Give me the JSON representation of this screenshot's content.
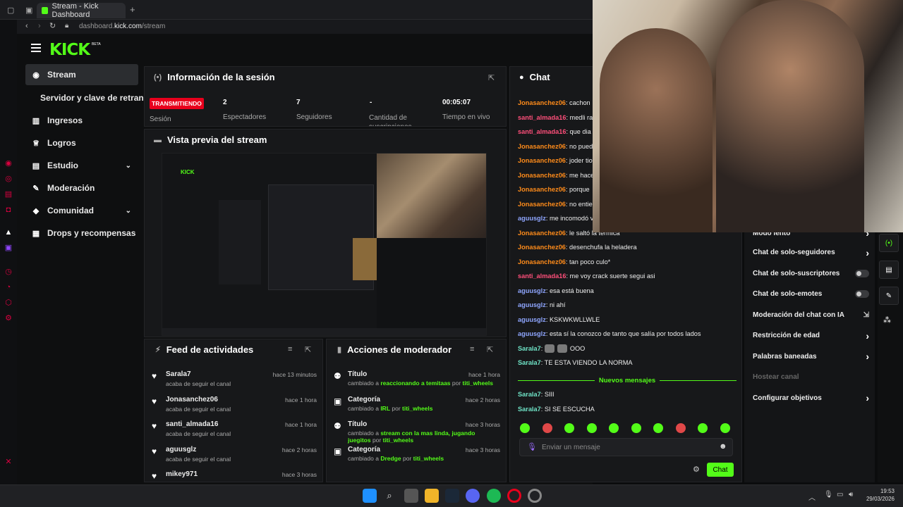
{
  "browser": {
    "tab_title": "Stream - Kick Dashboard",
    "url_domain": "dashboard.",
    "url_host": "kick.com",
    "url_path": "/stream"
  },
  "brand": {
    "logo": "KICK",
    "beta": "BETA",
    "accent": "#53fc18",
    "live_red": "#e8001c"
  },
  "sidebar": {
    "items": [
      {
        "label": "Stream",
        "icon": "broadcast-icon"
      },
      {
        "label": "Servidor y clave de retransmisión",
        "icon": ""
      },
      {
        "label": "Ingresos",
        "icon": "chart-icon"
      },
      {
        "label": "Logros",
        "icon": "trophy-icon"
      },
      {
        "label": "Estudio",
        "icon": "studio-icon"
      },
      {
        "label": "Moderación",
        "icon": "wrench-icon"
      },
      {
        "label": "Comunidad",
        "icon": "community-icon"
      },
      {
        "label": "Drops y recompensas",
        "icon": "gift-icon"
      }
    ]
  },
  "session": {
    "title": "Información de la sesión",
    "live_badge": "TRANSMITIENDO",
    "live_label": "Sesión",
    "stats": [
      {
        "value": "2",
        "label": "Espectadores"
      },
      {
        "value": "7",
        "label": "Seguidores"
      },
      {
        "value": "-",
        "label": "Cantidad de suscripciones"
      },
      {
        "value": "00:05:07",
        "label": "Tiempo en vivo"
      }
    ]
  },
  "preview": {
    "title": "Vista previa del stream"
  },
  "feed": {
    "title": "Feed de actividades",
    "items": [
      {
        "name": "Sarala7",
        "action": "acaba de seguir el canal",
        "time": "hace 13 minutos"
      },
      {
        "name": "Jonasanchez06",
        "action": "acaba de seguir el canal",
        "time": "hace 1 hora"
      },
      {
        "name": "santi_almada16",
        "action": "acaba de seguir el canal",
        "time": "hace 1 hora"
      },
      {
        "name": "aguusglz",
        "action": "acaba de seguir el canal",
        "time": "hace 2 horas"
      },
      {
        "name": "mikey971",
        "action": "",
        "time": "hace 3 horas"
      }
    ]
  },
  "modactions": {
    "title": "Acciones de moderador",
    "items": [
      {
        "kind": "Título",
        "prefix": "cambiado a ",
        "value": "reaccionando a temitaas",
        "by": " por ",
        "who": "titi_wheels",
        "time": "hace 1 hora",
        "icon": "title-icon"
      },
      {
        "kind": "Categoría",
        "prefix": "cambiado a ",
        "value": "IRL",
        "by": " por ",
        "who": "titi_wheels",
        "time": "hace 2 horas",
        "icon": "category-icon"
      },
      {
        "kind": "Título",
        "prefix": "cambiado a ",
        "value": "stream con la mas linda, jugando juegitos",
        "by": " por ",
        "who": "titi_wheels",
        "time": "hace 3 horas",
        "icon": "title-icon"
      },
      {
        "kind": "Categoría",
        "prefix": "cambiado a ",
        "value": "Dredge",
        "by": " por ",
        "who": "titi_wheels",
        "time": "hace 3 horas",
        "icon": "category-icon"
      }
    ]
  },
  "chat": {
    "title": "Chat",
    "lines": [
      {
        "user": "Jonasanchez06",
        "msg": "cachon",
        "color": "#ff8c1a"
      },
      {
        "user": "santi_almada16",
        "msg": "medli rar",
        "color": "#ff4f7a"
      },
      {
        "user": "santi_almada16",
        "msg": "que dia s",
        "color": "#ff4f7a"
      },
      {
        "user": "Jonasanchez06",
        "msg": "no pued",
        "color": "#ff8c1a"
      },
      {
        "user": "Jonasanchez06",
        "msg": "joder tio",
        "color": "#ff8c1a"
      },
      {
        "user": "Jonasanchez06",
        "msg": "me hace",
        "color": "#ff8c1a"
      },
      {
        "user": "Jonasanchez06",
        "msg": "porque",
        "color": "#ff8c1a"
      },
      {
        "user": "Jonasanchez06",
        "msg": "no entie",
        "color": "#ff8c1a"
      },
      {
        "user": "aguusglz",
        "msg": "me incomodó v",
        "color": "#8fa6ff"
      },
      {
        "user": "Jonasanchez06",
        "msg": "le saltó la térmica",
        "color": "#ff8c1a"
      },
      {
        "user": "Jonasanchez06",
        "msg": "desenchufa la heladera",
        "color": "#ff8c1a"
      },
      {
        "user": "Jonasanchez06",
        "msg": "tan poco culo*",
        "color": "#ff8c1a"
      },
      {
        "user": "santi_almada16",
        "msg": "me voy crack suerte segui asi",
        "color": "#ff4f7a"
      },
      {
        "user": "aguusglz",
        "msg": "esa está buena",
        "color": "#8fa6ff"
      },
      {
        "user": "aguusglz",
        "msg": "ni ahí",
        "color": "#8fa6ff"
      },
      {
        "user": "aguusglz",
        "msg": "KSKWKWLLWLE",
        "color": "#8fa6ff"
      },
      {
        "user": "aguusglz",
        "msg": "esta sí la conozco de tanto que salía por todos lados",
        "color": "#8fa6ff"
      },
      {
        "user": "Sarala7",
        "msg": "OOO",
        "color": "#6fe3c6"
      },
      {
        "user": "Sarala7",
        "msg": "TE ESTA VIENDO LA NORMA",
        "color": "#6fe3c6"
      }
    ],
    "new_messages": "Nuevos mensajes",
    "after": [
      {
        "user": "Sarala7",
        "msg": "SIII",
        "color": "#6fe3c6"
      },
      {
        "user": "Sarala7",
        "msg": "SI SE ESCUCHA",
        "color": "#6fe3c6"
      }
    ],
    "input_placeholder": "Enviar un mensaje",
    "send_label": "Chat"
  },
  "chat_settings": {
    "items": [
      {
        "label": "Modo lento",
        "control": "chevron"
      },
      {
        "label": "Chat de solo-seguidores",
        "control": "chevron"
      },
      {
        "label": "Chat de solo-suscriptores",
        "control": "toggle"
      },
      {
        "label": "Chat de solo-emotes",
        "control": "toggle"
      },
      {
        "label": "Moderación del chat con IA",
        "control": "external"
      },
      {
        "label": "Restricción de edad",
        "control": "chevron"
      },
      {
        "label": "Palabras baneadas",
        "control": "chevron"
      },
      {
        "label": "Hostear canal",
        "control": "none"
      },
      {
        "label": "Configurar objetivos",
        "control": "chevron"
      }
    ]
  },
  "taskbar": {
    "time": "19:53",
    "date": "29/03/2026"
  }
}
